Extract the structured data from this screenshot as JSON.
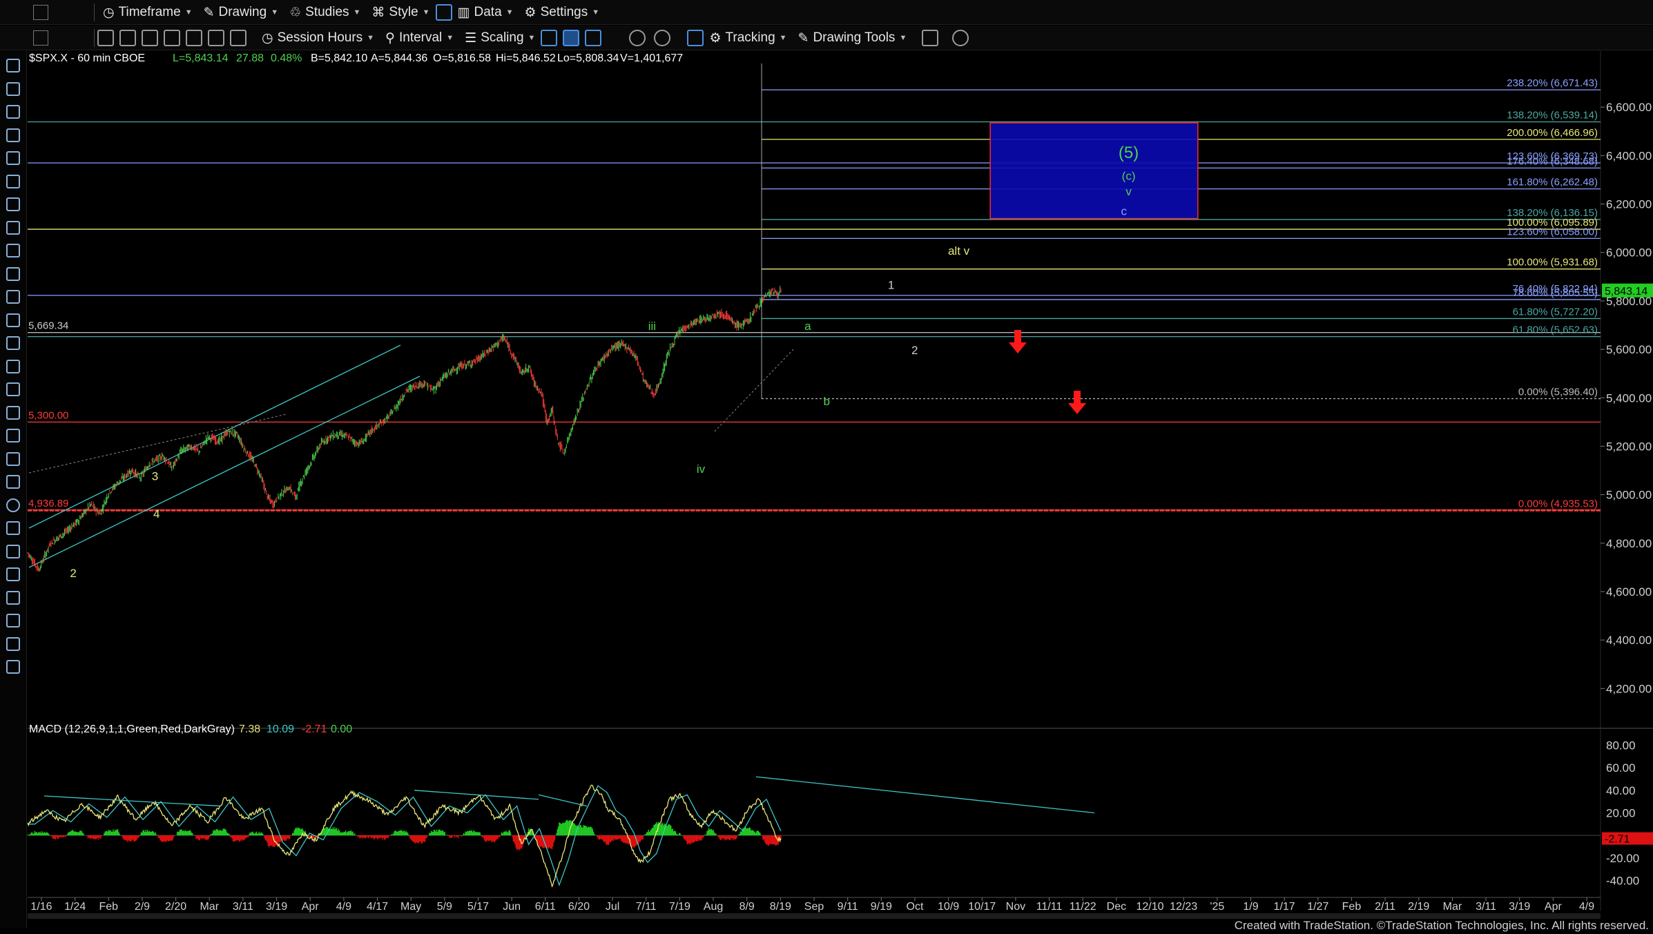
{
  "toolbar1": {
    "items": [
      {
        "name": "timeframe-menu",
        "label": "Timeframe",
        "icon": "clock-icon"
      },
      {
        "name": "drawing-menu",
        "label": "Drawing",
        "icon": "pencil-icon"
      },
      {
        "name": "studies-menu",
        "label": "Studies",
        "icon": "studies-icon"
      },
      {
        "name": "style-menu",
        "label": "Style",
        "icon": "style-icon"
      },
      {
        "name": "data-menu",
        "label": "Data",
        "icon": "bar-chart-icon"
      },
      {
        "name": "settings-menu",
        "label": "Settings",
        "icon": "gear-icon"
      }
    ]
  },
  "toolbar2": {
    "session_label": "Session Hours",
    "interval_label": "Interval",
    "scaling_label": "Scaling",
    "tracking_label": "Tracking",
    "drawing_tools_label": "Drawing Tools"
  },
  "symbol_header": {
    "symbol": "$SPX.X - 60 min  CBOE",
    "last": "L=5,843.14",
    "change": "27.88",
    "change_pct": "0.48%",
    "bid": "B=5,842.10",
    "ask": "A=5,844.36",
    "open": "O=5,816.58",
    "high": "Hi=5,846.52",
    "low": "Lo=5,808.34",
    "volume": "V=1,401,677"
  },
  "macd_header": {
    "label": "MACD (12,26,9,1,1,Green,Red,DarkGray)",
    "v1": "7.38",
    "v2": "10.09",
    "v3": "-2.71",
    "v4": "0.00"
  },
  "chart_data": {
    "type": "candlestick",
    "price_axis": {
      "range": [
        4050,
        6780
      ],
      "ticks": [
        "6,600.00",
        "6,400.00",
        "6,200.00",
        "6,000.00",
        "5,800.00",
        "5,600.00",
        "5,400.00",
        "5,200.00",
        "5,000.00",
        "4,800.00",
        "4,600.00",
        "4,400.00",
        "4,200.00"
      ],
      "tick_values": [
        6600,
        6400,
        6200,
        6000,
        5800,
        5600,
        5400,
        5200,
        5000,
        4800,
        4600,
        4400,
        4200
      ]
    },
    "macd_axis": {
      "range": [
        -55,
        95
      ],
      "ticks": [
        "80.00",
        "60.00",
        "40.00",
        "20.00",
        "-20.00",
        "-40.00"
      ],
      "tick_values": [
        80,
        60,
        40,
        20,
        -20,
        -40
      ]
    },
    "x_axis": {
      "ticks": [
        "1/16",
        "1/24",
        "Feb",
        "2/9",
        "2/20",
        "Mar",
        "3/11",
        "3/19",
        "Apr",
        "4/9",
        "4/17",
        "May",
        "5/9",
        "5/17",
        "Jun",
        "6/11",
        "6/20",
        "Jul",
        "7/11",
        "7/19",
        "Aug",
        "8/9",
        "8/19",
        "Sep",
        "9/11",
        "9/19",
        "Oct",
        "10/9",
        "10/17",
        "Nov",
        "11/11",
        "11/22",
        "Dec",
        "12/10",
        "12/23",
        "'25",
        "1/9",
        "1/17",
        "1/27",
        "Feb",
        "2/11",
        "2/19",
        "Mar",
        "3/11",
        "3/19",
        "Apr",
        "4/9"
      ]
    },
    "last_price": {
      "label": "5,843.14",
      "value": 5843.14
    },
    "macd_last": {
      "label": "-2.71",
      "value": -2.71
    },
    "price_path": [
      [
        0,
        4760
      ],
      [
        12,
        4690
      ],
      [
        25,
        4800
      ],
      [
        40,
        4840
      ],
      [
        55,
        4890
      ],
      [
        70,
        4960
      ],
      [
        80,
        4920
      ],
      [
        90,
        5010
      ],
      [
        100,
        5050
      ],
      [
        115,
        5100
      ],
      [
        125,
        5070
      ],
      [
        135,
        5130
      ],
      [
        150,
        5160
      ],
      [
        160,
        5110
      ],
      [
        170,
        5180
      ],
      [
        180,
        5200
      ],
      [
        190,
        5180
      ],
      [
        200,
        5240
      ],
      [
        212,
        5220
      ],
      [
        222,
        5260
      ],
      [
        232,
        5250
      ],
      [
        240,
        5190
      ],
      [
        250,
        5140
      ],
      [
        258,
        5080
      ],
      [
        266,
        4990
      ],
      [
        272,
        4960
      ],
      [
        280,
        5000
      ],
      [
        290,
        5030
      ],
      [
        297,
        4990
      ],
      [
        305,
        5070
      ],
      [
        315,
        5140
      ],
      [
        325,
        5210
      ],
      [
        335,
        5240
      ],
      [
        345,
        5250
      ],
      [
        355,
        5240
      ],
      [
        365,
        5210
      ],
      [
        372,
        5220
      ],
      [
        380,
        5260
      ],
      [
        390,
        5290
      ],
      [
        400,
        5320
      ],
      [
        410,
        5370
      ],
      [
        420,
        5430
      ],
      [
        430,
        5450
      ],
      [
        440,
        5460
      ],
      [
        450,
        5430
      ],
      [
        460,
        5480
      ],
      [
        470,
        5510
      ],
      [
        480,
        5530
      ],
      [
        490,
        5540
      ],
      [
        500,
        5560
      ],
      [
        510,
        5590
      ],
      [
        520,
        5620
      ],
      [
        528,
        5650
      ],
      [
        535,
        5600
      ],
      [
        542,
        5550
      ],
      [
        548,
        5500
      ],
      [
        556,
        5530
      ],
      [
        562,
        5460
      ],
      [
        570,
        5420
      ],
      [
        576,
        5300
      ],
      [
        582,
        5350
      ],
      [
        588,
        5220
      ],
      [
        595,
        5170
      ],
      [
        602,
        5260
      ],
      [
        612,
        5360
      ],
      [
        620,
        5440
      ],
      [
        630,
        5520
      ],
      [
        640,
        5570
      ],
      [
        650,
        5610
      ],
      [
        660,
        5620
      ],
      [
        668,
        5600
      ],
      [
        676,
        5560
      ],
      [
        684,
        5470
      ],
      [
        690,
        5440
      ],
      [
        695,
        5410
      ],
      [
        702,
        5470
      ],
      [
        710,
        5580
      ],
      [
        718,
        5640
      ],
      [
        725,
        5680
      ],
      [
        735,
        5700
      ],
      [
        745,
        5720
      ],
      [
        755,
        5730
      ],
      [
        765,
        5750
      ],
      [
        775,
        5740
      ],
      [
        785,
        5700
      ],
      [
        792,
        5700
      ],
      [
        800,
        5720
      ],
      [
        810,
        5780
      ],
      [
        818,
        5820
      ],
      [
        826,
        5840
      ],
      [
        832,
        5830
      ],
      [
        836,
        5843
      ]
    ],
    "macd_path": [
      [
        0,
        10
      ],
      [
        20,
        22
      ],
      [
        40,
        12
      ],
      [
        60,
        28
      ],
      [
        80,
        16
      ],
      [
        100,
        34
      ],
      [
        120,
        14
      ],
      [
        140,
        30
      ],
      [
        160,
        8
      ],
      [
        180,
        26
      ],
      [
        200,
        12
      ],
      [
        220,
        34
      ],
      [
        240,
        14
      ],
      [
        260,
        24
      ],
      [
        275,
        -6
      ],
      [
        290,
        -18
      ],
      [
        305,
        2
      ],
      [
        320,
        -4
      ],
      [
        340,
        24
      ],
      [
        360,
        38
      ],
      [
        380,
        30
      ],
      [
        400,
        18
      ],
      [
        420,
        34
      ],
      [
        440,
        8
      ],
      [
        460,
        26
      ],
      [
        480,
        20
      ],
      [
        500,
        36
      ],
      [
        520,
        14
      ],
      [
        535,
        26
      ],
      [
        548,
        -8
      ],
      [
        560,
        6
      ],
      [
        572,
        -20
      ],
      [
        582,
        -44
      ],
      [
        592,
        -22
      ],
      [
        602,
        6
      ],
      [
        615,
        28
      ],
      [
        625,
        44
      ],
      [
        635,
        38
      ],
      [
        645,
        22
      ],
      [
        655,
        16
      ],
      [
        665,
        2
      ],
      [
        672,
        -14
      ],
      [
        680,
        -24
      ],
      [
        690,
        -16
      ],
      [
        700,
        8
      ],
      [
        712,
        32
      ],
      [
        724,
        36
      ],
      [
        736,
        18
      ],
      [
        748,
        8
      ],
      [
        760,
        22
      ],
      [
        772,
        14
      ],
      [
        786,
        4
      ],
      [
        800,
        24
      ],
      [
        812,
        32
      ],
      [
        822,
        14
      ],
      [
        832,
        -3
      ]
    ],
    "fib_lines": [
      {
        "label": "238.20% (6,671.43)",
        "value": 6671.43,
        "color": "#8aa0ff",
        "from": 0.46
      },
      {
        "label": "138.20% (6,539.14)",
        "value": 6539.14,
        "color": "#4aa7a4",
        "from": 0
      },
      {
        "label": "200.00% (6,466.96)",
        "value": 6466.96,
        "color": "#e8e87a",
        "from": 0.46
      },
      {
        "label": "123.60% (6,369.73)",
        "value": 6369.73,
        "color": "#8aa0ff",
        "from": 0
      },
      {
        "label": "176.40% (6,348.68)",
        "value": 6348.68,
        "color": "#8aa0ff",
        "from": 0.46
      },
      {
        "label": "161.80% (6,262.48)",
        "value": 6262.48,
        "color": "#8aa0ff",
        "from": 0.46
      },
      {
        "label": "138.20% (6,136.15)",
        "value": 6136.15,
        "color": "#4aa7a4",
        "from": 0.46
      },
      {
        "label": "100.00% (6,095.89)",
        "value": 6095.89,
        "color": "#e8e87a",
        "from": 0
      },
      {
        "label": "123.60% (6,058.00)",
        "value": 6058.0,
        "color": "#8aa0ff",
        "from": 0.46
      },
      {
        "label": "100.00% (5,931.68)",
        "value": 5931.68,
        "color": "#e8e87a",
        "from": 0.46
      },
      {
        "label": "76.40% (5,822.94)",
        "value": 5822.94,
        "color": "#8aa0ff",
        "from": 0
      },
      {
        "label": "78.60% (5,805.55)",
        "value": 5805.55,
        "color": "#8aa0ff",
        "from": 0.46
      },
      {
        "label": "61.80% (5,727.20)",
        "value": 5727.2,
        "color": "#4aa7a4",
        "from": 0.46
      },
      {
        "label": "61.80% (5,652.63)",
        "value": 5652.63,
        "color": "#4aa7a4",
        "from": 0
      },
      {
        "label": "0.00% (5,396.40)",
        "value": 5396.4,
        "color": "#bbbbbb",
        "from": 0.46,
        "dashed": true
      },
      {
        "label": "0.00% (4,935.53)",
        "value": 4935.53,
        "color": "#ff3b3b",
        "from": 0,
        "thick": true
      }
    ],
    "level_lines": [
      {
        "label": "5,669.34",
        "value": 5669.34,
        "color": "#cccccc"
      },
      {
        "label": "5,300.00",
        "value": 5300.0,
        "color": "#ff3b3b"
      },
      {
        "label": "4,936.89",
        "value": 4936.89,
        "color": "#ff3b3b"
      }
    ],
    "target_box": {
      "price_top": 6535,
      "price_bottom": 6140,
      "x_from": 0.612,
      "x_to": 0.744
    },
    "wave_labels": [
      {
        "text": "(5)",
        "x": 0.7,
        "price": 6390,
        "color": "#4fd14f",
        "big": true
      },
      {
        "text": "(c)",
        "x": 0.7,
        "price": 6300,
        "color": "#4fd14f"
      },
      {
        "text": "v",
        "x": 0.7,
        "price": 6235,
        "color": "#4fd14f"
      },
      {
        "text": "c",
        "x": 0.697,
        "price": 6155,
        "color": "#8aa0ff"
      },
      {
        "text": "alt v",
        "x": 0.592,
        "price": 5990,
        "color": "#e8e87a"
      },
      {
        "text": "iii",
        "x": 0.397,
        "price": 5680,
        "color": "#4fd14f"
      },
      {
        "text": "iv",
        "x": 0.428,
        "price": 5090,
        "color": "#4fd14f"
      },
      {
        "text": "a",
        "x": 0.496,
        "price": 5680,
        "color": "#4fd14f"
      },
      {
        "text": "b",
        "x": 0.508,
        "price": 5370,
        "color": "#4fd14f"
      },
      {
        "text": "1",
        "x": 0.549,
        "price": 5850,
        "color": "#cccccc"
      },
      {
        "text": "2",
        "x": 0.564,
        "price": 5580,
        "color": "#cccccc"
      },
      {
        "text": "3",
        "x": 0.081,
        "price": 5060,
        "color": "#e8e87a"
      },
      {
        "text": "4",
        "x": 0.082,
        "price": 4905,
        "color": "#e8e87a"
      },
      {
        "text": "2",
        "x": 0.029,
        "price": 4660,
        "color": "#e8e87a"
      }
    ]
  },
  "footer": "Created with TradeStation. ©TradeStation Technologies, Inc. All rights reserved."
}
